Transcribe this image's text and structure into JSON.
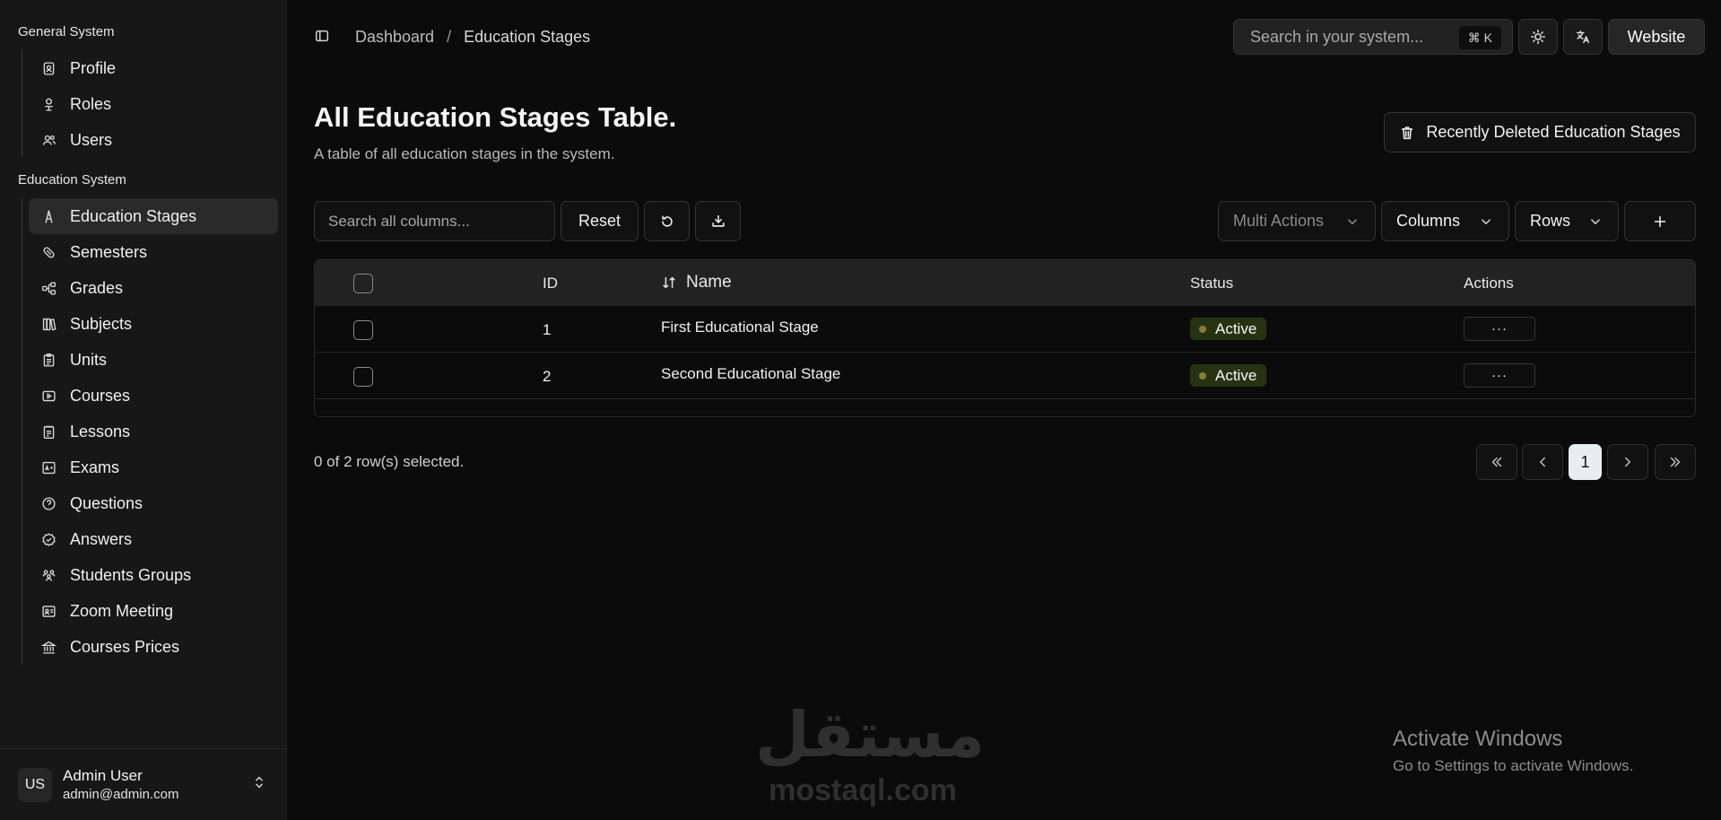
{
  "sidebar": {
    "group_general": "General System",
    "group_education": "Education System",
    "general_items": [
      {
        "label": "Profile",
        "icon": "profile-icon"
      },
      {
        "label": "Roles",
        "icon": "roles-icon"
      },
      {
        "label": "Users",
        "icon": "users-icon"
      }
    ],
    "education_items": [
      {
        "label": "Education Stages",
        "icon": "ladder-icon",
        "active": true
      },
      {
        "label": "Semesters",
        "icon": "pill-icon"
      },
      {
        "label": "Grades",
        "icon": "hierarchy-icon"
      },
      {
        "label": "Subjects",
        "icon": "books-icon"
      },
      {
        "label": "Units",
        "icon": "clipboard-icon"
      },
      {
        "label": "Courses",
        "icon": "video-icon"
      },
      {
        "label": "Lessons",
        "icon": "notepad-icon"
      },
      {
        "label": "Exams",
        "icon": "exam-icon"
      },
      {
        "label": "Questions",
        "icon": "question-icon"
      },
      {
        "label": "Answers",
        "icon": "check-circle-icon"
      },
      {
        "label": "Students Groups",
        "icon": "group-icon"
      },
      {
        "label": "Zoom Meeting",
        "icon": "meeting-icon"
      },
      {
        "label": "Courses Prices",
        "icon": "bank-icon"
      }
    ],
    "user": {
      "initials": "US",
      "name": "Admin User",
      "email": "admin@admin.com"
    }
  },
  "header": {
    "breadcrumb": [
      "Dashboard",
      "Education Stages"
    ],
    "breadcrumb_sep": "/",
    "search_placeholder": "Search in your system...",
    "search_shortcut": "⌘ K",
    "website_label": "Website"
  },
  "main": {
    "title": "All Education Stages Table.",
    "subtitle": "A table of all education stages in the system.",
    "deleted_button": "Recently Deleted Education Stages"
  },
  "toolbar": {
    "search_placeholder": "Search all columns...",
    "reset_label": "Reset",
    "multi_actions_label": "Multi Actions",
    "columns_label": "Columns",
    "rows_label": "Rows"
  },
  "table": {
    "headers": {
      "id": "ID",
      "name": "Name",
      "status": "Status",
      "actions": "Actions"
    },
    "rows": [
      {
        "id": "1",
        "name": "First Educational Stage",
        "status": "Active"
      },
      {
        "id": "2",
        "name": "Second Educational Stage",
        "status": "Active"
      }
    ],
    "actions_glyph": "···"
  },
  "footer": {
    "selected_text": "0 of 2 row(s) selected.",
    "current_page": "1"
  },
  "watermark": {
    "arabic": "مستقل",
    "latin": "mostaql.com"
  },
  "activate_windows": {
    "title": "Activate Windows",
    "subtitle": "Go to Settings to activate Windows."
  },
  "colors": {
    "background": "#0b0b0b",
    "sidebar": "#171717",
    "active_badge": "#263312",
    "page_active": "#e6eef0"
  }
}
